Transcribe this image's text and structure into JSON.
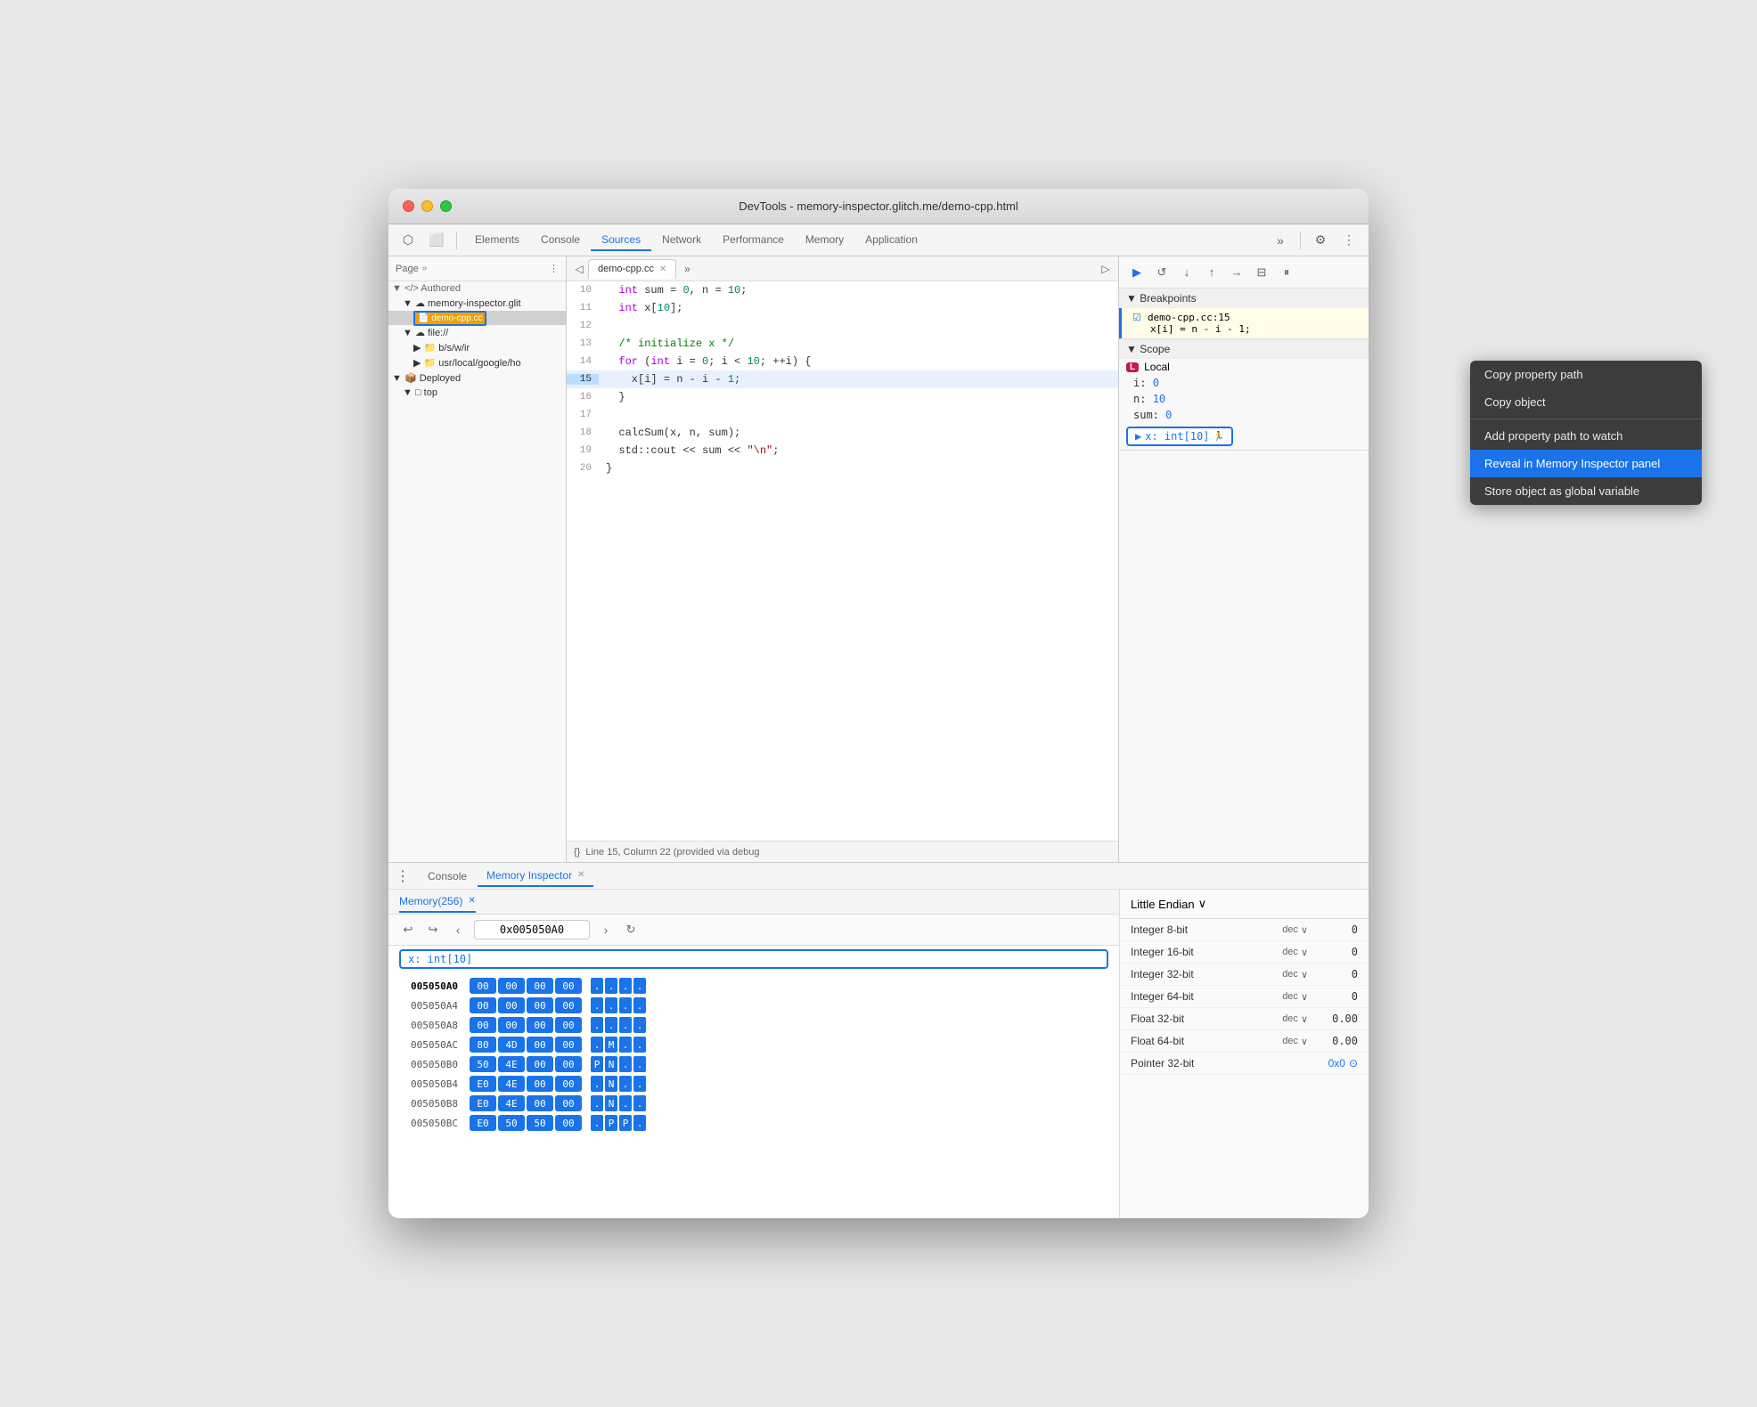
{
  "window": {
    "title": "DevTools - memory-inspector.glitch.me/demo-cpp.html",
    "traffic_lights": [
      "red",
      "yellow",
      "green"
    ]
  },
  "main_tabs": [
    {
      "label": "Elements",
      "active": false
    },
    {
      "label": "Console",
      "active": false
    },
    {
      "label": "Sources",
      "active": true
    },
    {
      "label": "Network",
      "active": false
    },
    {
      "label": "Performance",
      "active": false
    },
    {
      "label": "Memory",
      "active": false
    },
    {
      "label": "Application",
      "active": false
    }
  ],
  "file_panel": {
    "header_label": "Page",
    "tree": [
      {
        "label": "▼ </> Authored",
        "indent": 0
      },
      {
        "label": "▼ ☁ memory-inspector.glit",
        "indent": 1
      },
      {
        "label": "demo-cpp.cc",
        "indent": 2,
        "selected": true,
        "file": true
      },
      {
        "label": "▼ ☁ file://",
        "indent": 1
      },
      {
        "label": "▶ 📁 b/s/w/ir",
        "indent": 2
      },
      {
        "label": "▶ 📁 usr/local/google/ho",
        "indent": 2
      },
      {
        "label": "▼ 📦 Deployed",
        "indent": 0
      },
      {
        "label": "▼ □ top",
        "indent": 1
      }
    ]
  },
  "code_panel": {
    "tab_label": "demo-cpp.cc",
    "lines": [
      {
        "num": 10,
        "content": "  int sum = 0, n = 10;"
      },
      {
        "num": 11,
        "content": "  int x[10];"
      },
      {
        "num": 12,
        "content": ""
      },
      {
        "num": 13,
        "content": "  /* initialize x */"
      },
      {
        "num": 14,
        "content": "  for (int i = 0; i < 10; ++i) {"
      },
      {
        "num": 15,
        "content": "    x[i] = n - i - 1;",
        "highlighted": true
      },
      {
        "num": 16,
        "content": "  }"
      },
      {
        "num": 17,
        "content": ""
      },
      {
        "num": 18,
        "content": "  calcSum(x, n, sum);"
      },
      {
        "num": 19,
        "content": "  std::cout << sum << \"\\n\";"
      },
      {
        "num": 20,
        "content": "}"
      }
    ],
    "status_bar": "Line 15, Column 22 (provided via debug"
  },
  "debug_panel": {
    "breakpoints_label": "▼ Breakpoints",
    "breakpoint": {
      "file": "demo-cpp.cc:15",
      "code": "x[i] = n - i - 1;"
    },
    "scope_label": "▼ Scope",
    "scope_local_label": "▼ Local",
    "scope_vars": [
      {
        "name": "i:",
        "value": "0"
      },
      {
        "name": "n:",
        "value": "10"
      },
      {
        "name": "sum:",
        "value": "0"
      }
    ],
    "x_badge_label": "▶ x: int[10]",
    "x_badge_icon": "🏃"
  },
  "bottom_tabs": [
    {
      "label": "Console",
      "active": false
    },
    {
      "label": "Memory Inspector",
      "active": true
    },
    {
      "close": true
    }
  ],
  "memory_panel": {
    "memory_tab_label": "Memory(256)",
    "address": "0x005050A0",
    "x_badge": "x: int[10]",
    "rows": [
      {
        "addr": "005050A0",
        "bytes": [
          "00",
          "00",
          "00",
          "00"
        ],
        "chars": [
          ".",
          ".",
          ".",
          ".",
          "."
        ],
        "highlighted": true
      },
      {
        "addr": "005050A4",
        "bytes": [
          "00",
          "00",
          "00",
          "00"
        ],
        "chars": [
          ".",
          ".",
          ".",
          ".",
          ".",
          "."
        ]
      },
      {
        "addr": "005050A8",
        "bytes": [
          "00",
          "00",
          "00",
          "00"
        ],
        "chars": [
          ".",
          ".",
          ".",
          ".",
          "."
        ]
      },
      {
        "addr": "005050AC",
        "bytes": [
          "80",
          "4D",
          "00",
          "00"
        ],
        "chars": [
          ".",
          ".",
          "M",
          ".",
          ".",
          "."
        ]
      },
      {
        "addr": "005050B0",
        "bytes": [
          "50",
          "4E",
          "00",
          "00"
        ],
        "chars": [
          ".",
          "P",
          "N",
          ".",
          ".",
          "."
        ]
      },
      {
        "addr": "005050B4",
        "bytes": [
          "E0",
          "4E",
          "00",
          "00"
        ],
        "chars": [
          ".",
          "N",
          ".",
          ".",
          "."
        ]
      },
      {
        "addr": "005050B8",
        "bytes": [
          "E0",
          "4E",
          "00",
          "00"
        ],
        "chars": [
          ".",
          "N",
          ".",
          ".",
          "."
        ]
      },
      {
        "addr": "005050BC",
        "bytes": [
          "E0",
          "50",
          "50",
          "00"
        ],
        "chars": [
          ".",
          "P",
          "P",
          ".",
          "."
        ]
      }
    ]
  },
  "memory_details": {
    "endian_label": "Little Endian",
    "rows": [
      {
        "label": "Integer 8-bit",
        "format": "dec",
        "value": "0"
      },
      {
        "label": "Integer 16-bit",
        "format": "dec",
        "value": "0"
      },
      {
        "label": "Integer 32-bit",
        "format": "dec",
        "value": "0"
      },
      {
        "label": "Integer 64-bit",
        "format": "dec",
        "value": "0"
      },
      {
        "label": "Float 32-bit",
        "format": "dec",
        "value": "0.00"
      },
      {
        "label": "Float 64-bit",
        "format": "dec",
        "value": "0.00"
      },
      {
        "label": "Pointer 32-bit",
        "format": "",
        "value": "0x0",
        "link": true
      }
    ]
  },
  "context_menu": {
    "items": [
      {
        "label": "Copy property path",
        "active": false
      },
      {
        "label": "Copy object",
        "active": false,
        "separator_after": true
      },
      {
        "label": "Add property path to watch",
        "active": false
      },
      {
        "label": "Reveal in Memory Inspector panel",
        "active": true
      },
      {
        "label": "Store object as global variable",
        "active": false
      }
    ]
  }
}
